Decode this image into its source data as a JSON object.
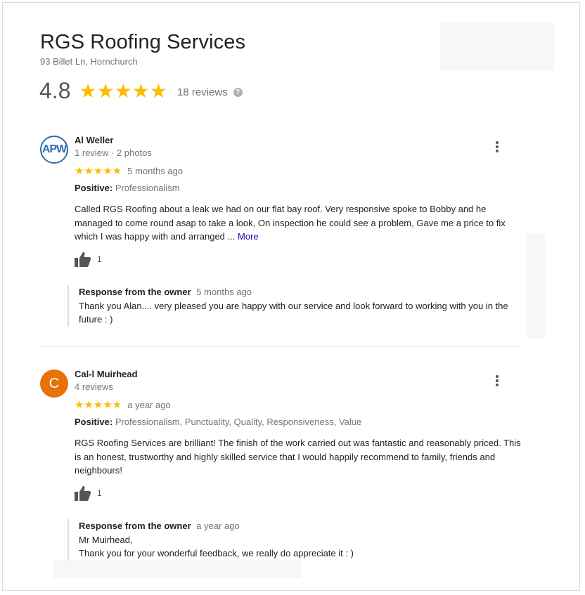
{
  "business": {
    "name": "RGS Roofing Services",
    "address": "93 Billet Ln, Hornchurch",
    "rating": "4.8",
    "stars": "★★★★★",
    "review_count": "18 reviews",
    "help_glyph": "?"
  },
  "reviews": [
    {
      "avatar_text": "APW",
      "name": "Al Weller",
      "meta": "1 review · 2 photos",
      "stars": "★★★★★",
      "when": "5 months ago",
      "positive_label": "Positive:",
      "positive_tags": "Professionalism",
      "text": "Called RGS Roofing about a leak we had on our flat bay roof. Very responsive spoke to Bobby and he managed to come round asap to take a look, On inspection he could see a problem, Gave me a price to fix which I was happy with and arranged ...",
      "more_label": "More",
      "likes": "1",
      "owner_label": "Response from the owner",
      "owner_when": "5 months ago",
      "owner_text": "Thank you Alan.... very pleased you are happy with our service and look forward to working with you in the future : )"
    },
    {
      "avatar_text": "C",
      "avatar_color": "#e8710a",
      "name": "Cal-l Muirhead",
      "meta": "4 reviews",
      "stars": "★★★★★",
      "when": "a year ago",
      "positive_label": "Positive:",
      "positive_tags": "Professionalism, Punctuality, Quality, Responsiveness, Value",
      "text": "RGS Roofing Services are brilliant! The finish of the work carried out was fantastic and reasonably priced. This is an honest, trustworthy and highly skilled service that I would happily recommend to family, friends and neighbours!",
      "likes": "1",
      "owner_label": "Response from the owner",
      "owner_when": "a year ago",
      "owner_line1": "Mr Muirhead,",
      "owner_line2": "Thank you for your wonderful feedback, we really do appreciate it : )"
    }
  ],
  "colors": {
    "star": "#fbbc04",
    "link": "#1a0dab",
    "muted": "#70757a"
  },
  "icons": [
    "help-icon",
    "thumbs-up-icon",
    "more-vert-icon"
  ]
}
